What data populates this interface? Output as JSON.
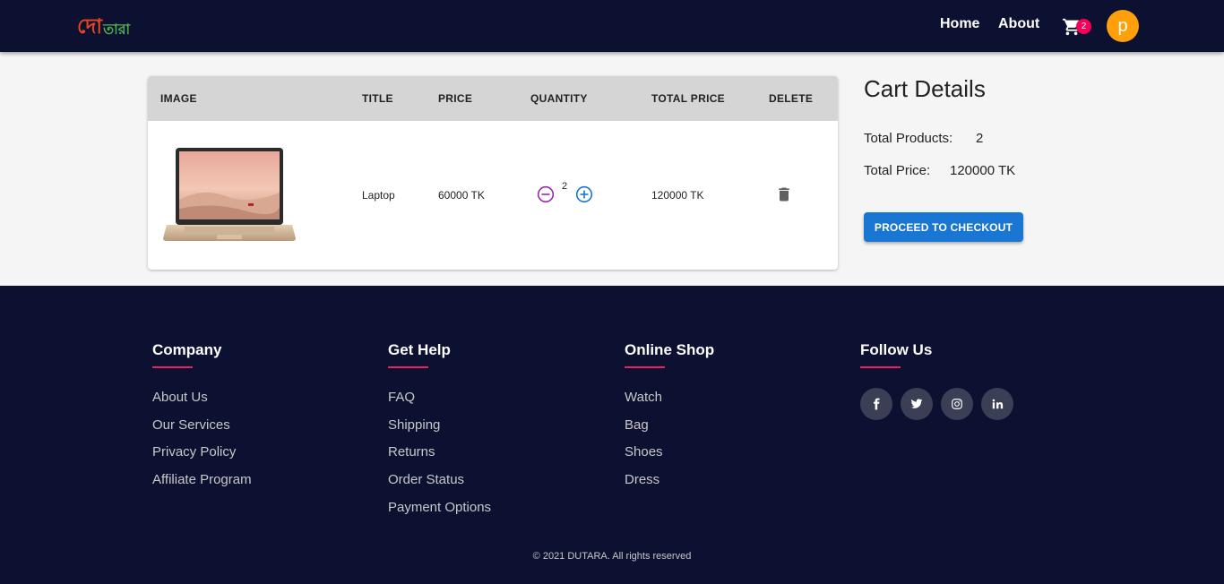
{
  "navbar": {
    "logo_part1": "দো",
    "logo_part2": "তারা",
    "home_label": "Home",
    "about_label": "About",
    "cart_count": "2",
    "avatar_initial": "p"
  },
  "cart_table": {
    "headers": [
      "IMAGE",
      "TITLE",
      "PRICE",
      "QUANTITY",
      "TOTAL PRICE",
      "DELETE"
    ],
    "rows": [
      {
        "title": "Laptop",
        "price": "60000 TK",
        "quantity": "2",
        "total_price": "120000 TK"
      }
    ]
  },
  "cart_details": {
    "title": "Cart Details",
    "total_products_label": "Total Products:",
    "total_products_value": "2",
    "total_price_label": "Total Price:",
    "total_price_value": "120000 TK",
    "checkout_label": "PROCEED TO CHECKOUT"
  },
  "footer": {
    "columns": [
      {
        "title": "Company",
        "items": [
          "About Us",
          "Our Services",
          "Privacy Policy",
          "Affiliate Program"
        ]
      },
      {
        "title": "Get Help",
        "items": [
          "FAQ",
          "Shipping",
          "Returns",
          "Order Status",
          "Payment Options"
        ]
      },
      {
        "title": "Online Shop",
        "items": [
          "Watch",
          "Bag",
          "Shoes",
          "Dress"
        ]
      },
      {
        "title": "Follow Us"
      }
    ],
    "socials": [
      "facebook-icon",
      "twitter-icon",
      "instagram-icon",
      "linkedin-icon"
    ],
    "copyright": "© 2021 DUTARA. All rights reserved"
  },
  "colors": {
    "navy": "#0c1131",
    "accent_pink": "#e91e63",
    "badge": "#f50057",
    "avatar": "#ff9f0a",
    "primary_blue": "#1976d2"
  }
}
